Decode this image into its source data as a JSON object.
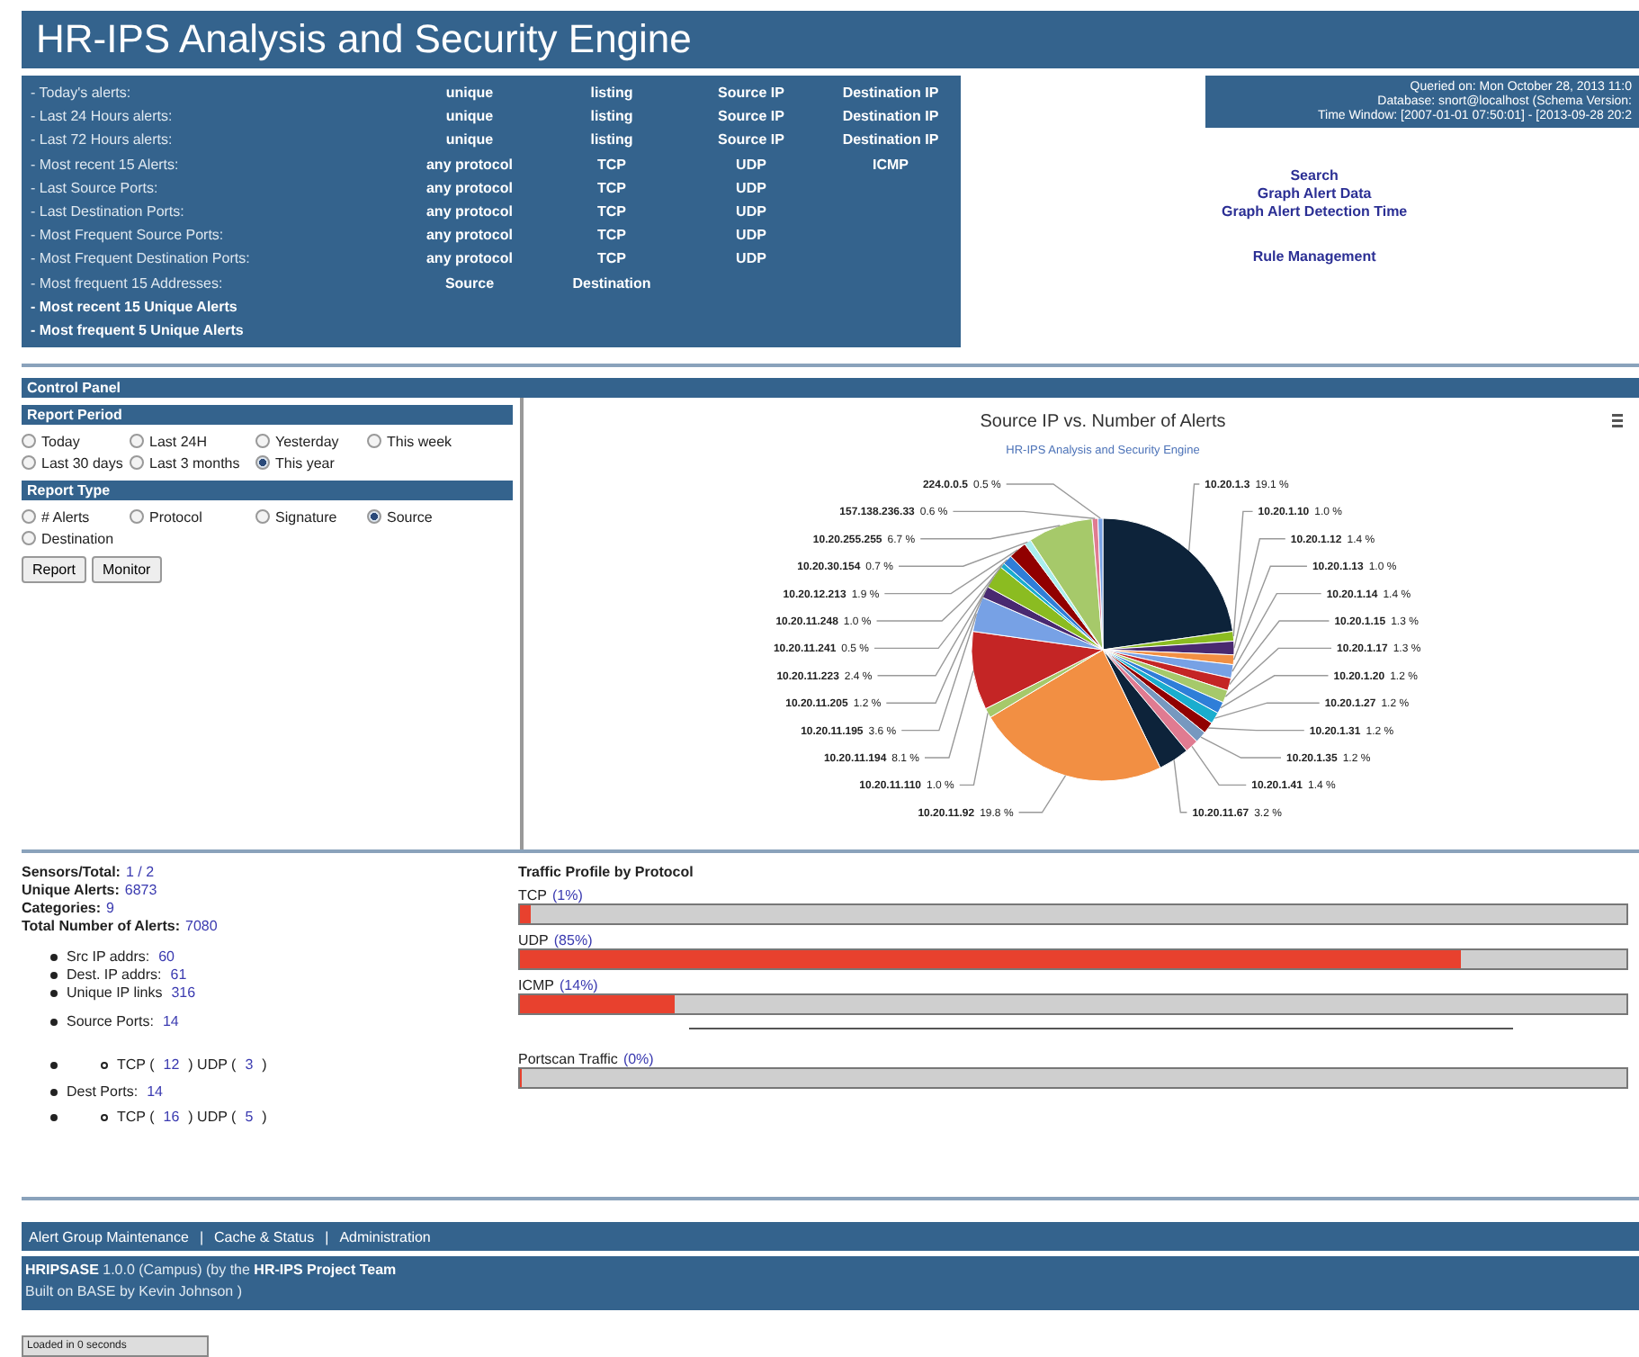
{
  "title": "HR-IPS Analysis and Security Engine",
  "alert_rows": [
    {
      "kind": "link",
      "label": "- Today's alerts:",
      "links": [
        "unique",
        "listing",
        "Source IP",
        "Destination IP"
      ]
    },
    {
      "kind": "link",
      "label": "- Last 24 Hours alerts:",
      "links": [
        "unique",
        "listing",
        "Source IP",
        "Destination IP"
      ]
    },
    {
      "kind": "link",
      "label": "- Last 72 Hours alerts:",
      "links": [
        "unique",
        "listing",
        "Source IP",
        "Destination IP"
      ]
    },
    {
      "kind": "link",
      "label": "- Most recent 15 Alerts:",
      "links": [
        "any protocol",
        "TCP",
        "UDP",
        "ICMP"
      ]
    },
    {
      "kind": "link",
      "label": "- Last Source Ports:",
      "links": [
        "any protocol",
        "TCP",
        "UDP"
      ]
    },
    {
      "kind": "link",
      "label": "- Last Destination Ports:",
      "links": [
        "any protocol",
        "TCP",
        "UDP"
      ]
    },
    {
      "kind": "link",
      "label": "- Most Frequent Source Ports:",
      "links": [
        "any protocol",
        "TCP",
        "UDP"
      ]
    },
    {
      "kind": "link",
      "label": "- Most Frequent Destination Ports:",
      "links": [
        "any protocol",
        "TCP",
        "UDP"
      ]
    },
    {
      "kind": "link",
      "label": "- Most frequent 15 Addresses:",
      "links": [
        "Source",
        "Destination"
      ]
    },
    {
      "kind": "heading",
      "label": "- Most recent 15 Unique Alerts"
    },
    {
      "kind": "heading",
      "label": "- Most frequent 5 Unique Alerts"
    }
  ],
  "query_info": [
    "Queried on: Mon October 28, 2013 11:0",
    "Database: snort@localhost   (Schema Version:",
    "Time Window: [2007-01-01 07:50:01] - [2013-09-28 20:2"
  ],
  "nav_groups": [
    [
      "Search",
      "Graph Alert Data",
      "Graph Alert Detection Time"
    ],
    [
      "Rule Management"
    ]
  ],
  "control_panel": {
    "title": "Control Panel",
    "sections": [
      {
        "title": "Report Period",
        "options": [
          {
            "label": "Today",
            "selected": false
          },
          {
            "label": "Last 24H",
            "selected": false
          },
          {
            "label": "Yesterday",
            "selected": false
          },
          {
            "label": "This week",
            "selected": false
          },
          {
            "label": "Last 30 days",
            "selected": false
          },
          {
            "label": "Last 3 months",
            "selected": false
          },
          {
            "label": "This year",
            "selected": true
          }
        ]
      },
      {
        "title": "Report Type",
        "options": [
          {
            "label": "# Alerts",
            "selected": false
          },
          {
            "label": "Protocol",
            "selected": false
          },
          {
            "label": "Signature",
            "selected": false
          },
          {
            "label": "Source",
            "selected": true
          },
          {
            "label": "Destination",
            "selected": false
          }
        ]
      }
    ],
    "buttons": [
      "Report",
      "Monitor"
    ]
  },
  "chart": {
    "subtitle": "HR-IPS Analysis and Security Engine",
    "chart_data": {
      "type": "pie",
      "title": "Source IP vs. Number of Alerts",
      "categories": [
        "10.20.1.3",
        "10.20.1.10",
        "10.20.1.12",
        "10.20.1.13",
        "10.20.1.14",
        "10.20.1.15",
        "10.20.1.17",
        "10.20.1.20",
        "10.20.1.27",
        "10.20.1.31",
        "10.20.1.35",
        "10.20.1.41",
        "10.20.11.67",
        "10.20.11.92",
        "10.20.11.110",
        "10.20.11.194",
        "10.20.11.195",
        "10.20.11.205",
        "10.20.11.223",
        "10.20.11.241",
        "10.20.11.248",
        "10.20.12.213",
        "10.20.30.154",
        "10.20.255.255",
        "157.138.236.33",
        "224.0.0.5"
      ],
      "values": [
        19.1,
        1.0,
        1.4,
        1.0,
        1.4,
        1.3,
        1.3,
        1.2,
        1.2,
        1.2,
        1.2,
        1.4,
        3.2,
        19.8,
        1.0,
        8.1,
        3.6,
        1.2,
        2.4,
        0.5,
        1.0,
        1.9,
        0.7,
        6.7,
        0.6,
        0.5
      ],
      "value_labels": [
        "19.1 %",
        "1.0 %",
        "1.4 %",
        "1.0 %",
        "1.4 %",
        "1.3 %",
        "1.3 %",
        "1.2 %",
        "1.2 %",
        "1.2 %",
        "1.2 %",
        "1.4 %",
        "3.2 %",
        "19.8 %",
        "1.0 %",
        "8.1 %",
        "3.6 %",
        "1.2 %",
        "2.4 %",
        "0.5 %",
        "1.0 %",
        "1.9 %",
        "0.7 %",
        "6.7 %",
        "0.6 %",
        "0.5 %"
      ]
    }
  },
  "stats": [
    {
      "label": "Sensors/Total:",
      "value": "1 / 2"
    },
    {
      "label": "Unique Alerts:",
      "value": "6873"
    },
    {
      "label": "Categories:",
      "value": "9"
    },
    {
      "label": "Total Number of Alerts:",
      "value": "7080"
    }
  ],
  "addr_items": [
    {
      "label": "Src IP addrs:",
      "value": "60"
    },
    {
      "label": "Dest. IP addrs:",
      "value": "61"
    },
    {
      "label": "Unique IP links",
      "value": "316"
    }
  ],
  "port_groups": [
    {
      "label": "Source Ports:",
      "value": "14",
      "parts": [
        "TCP (",
        "12",
        ")  UDP (",
        "3",
        ")"
      ]
    },
    {
      "label": "Dest Ports:",
      "value": "14",
      "parts": [
        "TCP (",
        "16",
        ")  UDP (",
        "5",
        ")"
      ]
    }
  ],
  "traffic": {
    "title": "Traffic Profile by Protocol",
    "bars": [
      {
        "label": "TCP",
        "percent": "(1%)",
        "level": 0.01
      },
      {
        "label": "UDP",
        "percent": "(85%)",
        "level": 0.85
      },
      {
        "label": "ICMP",
        "percent": "(14%)",
        "level": 0.14
      },
      {
        "label": "Portscan Traffic",
        "percent": "(0%)",
        "level": 0
      }
    ]
  },
  "footer_links": [
    "Alert Group Maintenance",
    "Cache & Status",
    "Administration"
  ],
  "footer_separator": "|",
  "credits": {
    "line1": "**HRIPSASE** 1.0.0 (Campus) (by the **HR-IPS Project Team**",
    "line2": "Built on BASE by Kevin Johnson )"
  },
  "load_time": "Loaded in 0 seconds"
}
